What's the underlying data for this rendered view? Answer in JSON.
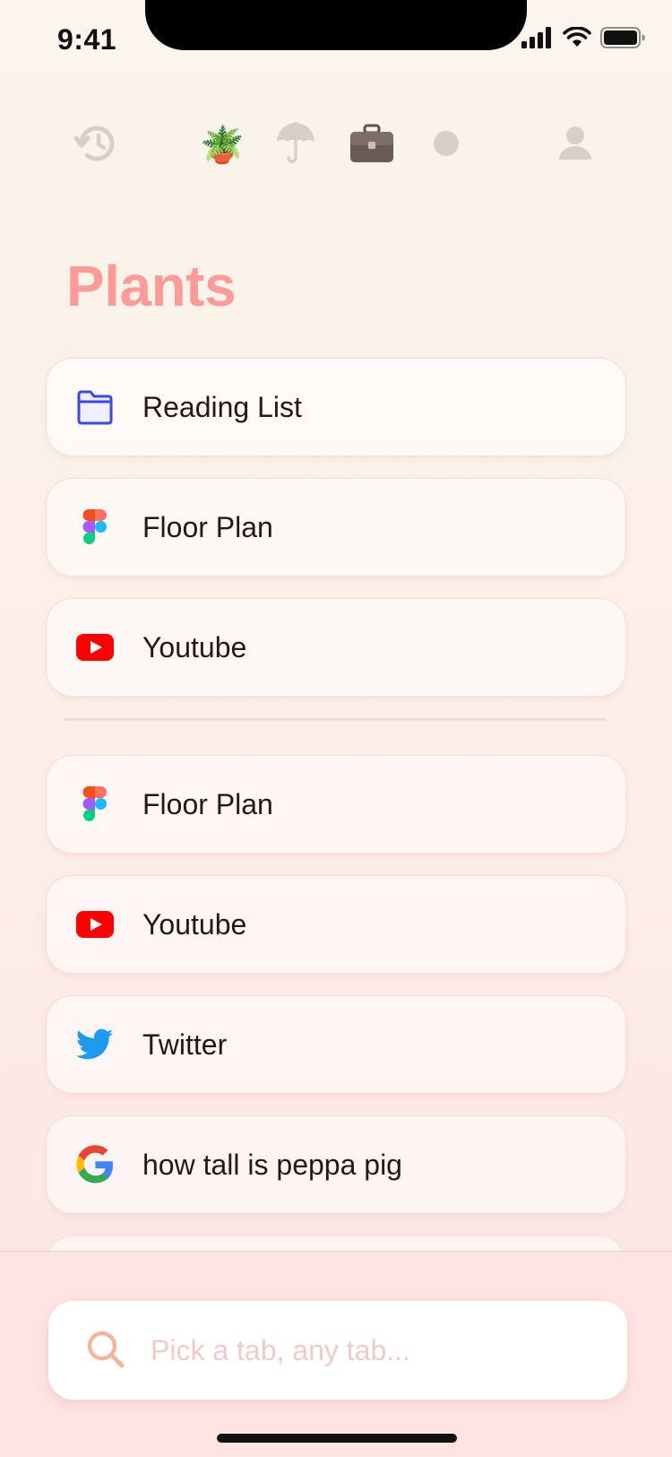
{
  "status_bar": {
    "time": "9:41",
    "icons": [
      "cellular-signal-icon",
      "wifi-icon",
      "battery-icon"
    ]
  },
  "toolbar": {
    "items": [
      {
        "name": "history-icon",
        "glyph": ""
      },
      {
        "name": "plant-icon",
        "glyph": "🪴"
      },
      {
        "name": "umbrella-icon",
        "glyph": "☂"
      },
      {
        "name": "briefcase-icon",
        "glyph": "💼"
      },
      {
        "name": "dot-icon",
        "glyph": ""
      },
      {
        "name": "profile-icon",
        "glyph": ""
      }
    ]
  },
  "page": {
    "title": "Plants"
  },
  "pinned_tabs": [
    {
      "label": "Reading List",
      "icon": "folder-icon"
    },
    {
      "label": "Floor Plan",
      "icon": "figma-icon"
    },
    {
      "label": "Youtube",
      "icon": "youtube-icon"
    }
  ],
  "tabs": [
    {
      "label": "Floor Plan",
      "icon": "figma-icon"
    },
    {
      "label": "Youtube",
      "icon": "youtube-icon"
    },
    {
      "label": "Twitter",
      "icon": "twitter-icon"
    },
    {
      "label": "how tall is peppa pig",
      "icon": "google-icon"
    }
  ],
  "search": {
    "placeholder": "Pick a tab, any tab...",
    "value": ""
  },
  "colors": {
    "title": "#fd9b98",
    "accent_search_icon": "#f3b69c",
    "youtube": "#ff0000",
    "twitter": "#1d9bf0",
    "folder": "#3d46e8"
  }
}
